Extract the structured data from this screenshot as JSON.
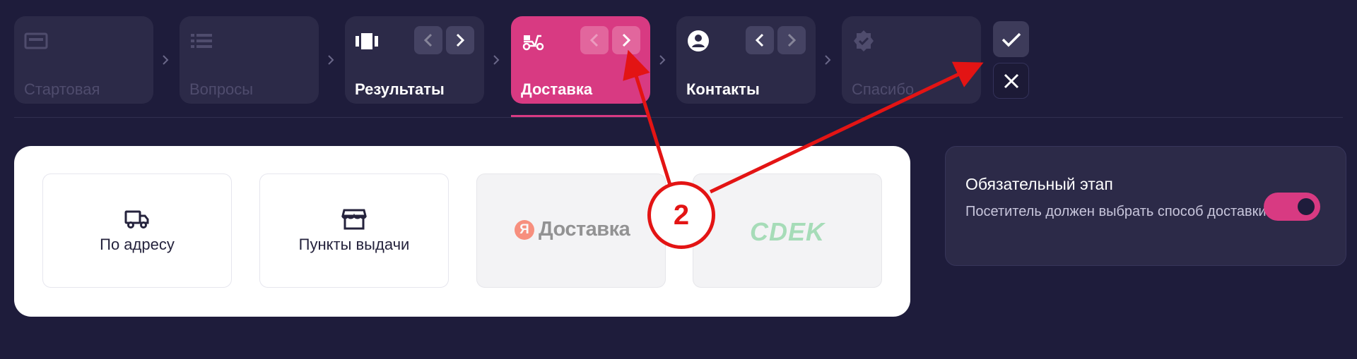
{
  "steps": [
    {
      "label": "Стартовая",
      "icon": "window-icon",
      "state": "disabled"
    },
    {
      "label": "Вопросы",
      "icon": "list-icon",
      "state": "disabled"
    },
    {
      "label": "Результаты",
      "icon": "columns-icon",
      "state": "enabled"
    },
    {
      "label": "Доставка",
      "icon": "scooter-icon",
      "state": "active"
    },
    {
      "label": "Контакты",
      "icon": "person-icon",
      "state": "enabled"
    },
    {
      "label": "Спасибо",
      "icon": "verified-badge-icon",
      "state": "disabled"
    }
  ],
  "delivery_options": [
    {
      "label": "По адресу",
      "icon": "truck-icon"
    },
    {
      "label": "Пункты выдачи",
      "icon": "store-icon"
    },
    {
      "label": "Доставка",
      "logo_letter": "Я",
      "icon": "yandex-delivery-logo"
    },
    {
      "label": "СDEK",
      "icon": "cdek-logo"
    }
  ],
  "required_stage": {
    "title": "Обязательный этап",
    "description": "Посетитель должен выбрать способ доставки",
    "enabled": true
  },
  "annotation": {
    "number": "2"
  },
  "colors": {
    "background": "#1e1c3b",
    "step": "#2c2a48",
    "accent": "#d83a82",
    "annotation": "#e31414"
  }
}
